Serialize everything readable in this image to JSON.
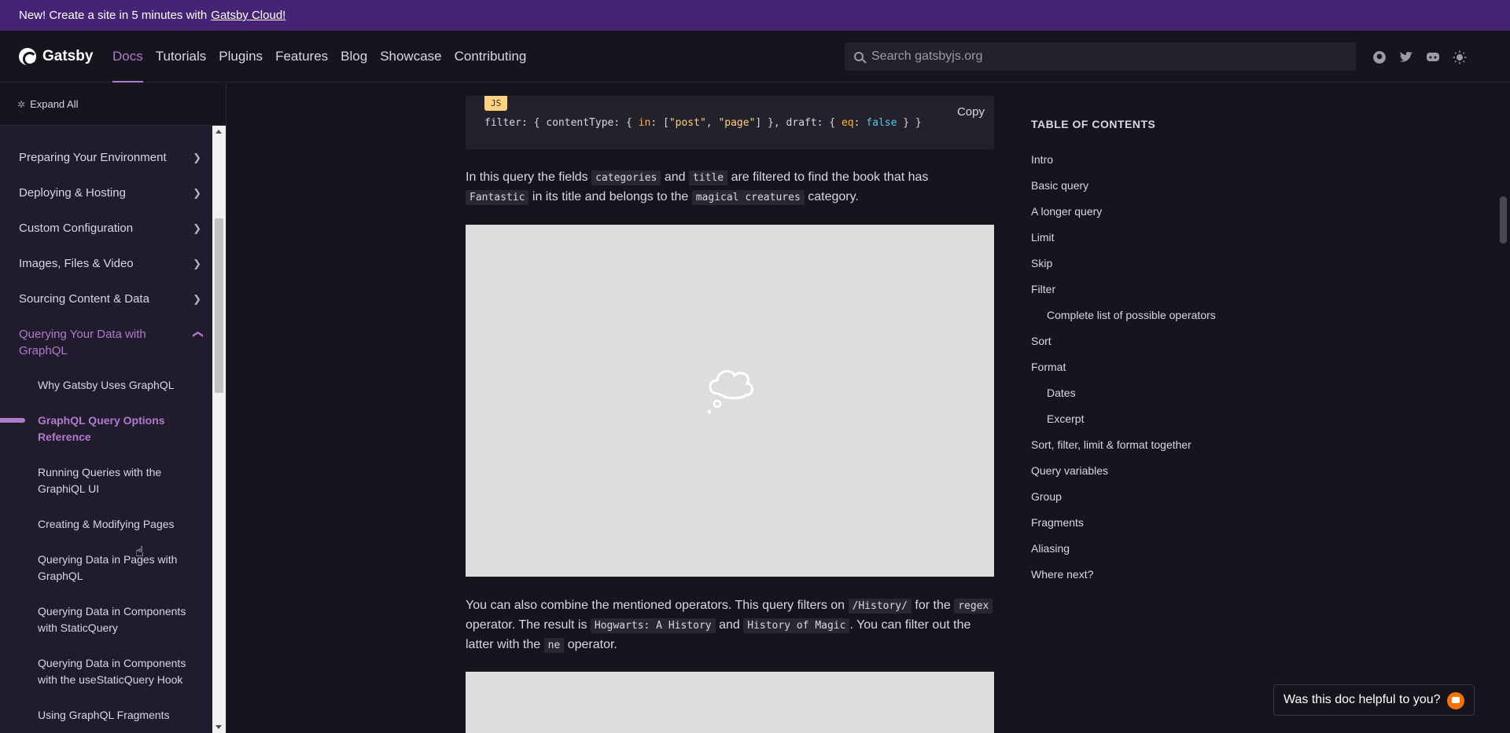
{
  "banner": {
    "text": "New! Create a site in 5 minutes with",
    "link": "Gatsby Cloud!"
  },
  "header": {
    "logo": "Gatsby",
    "nav": [
      "Docs",
      "Tutorials",
      "Plugins",
      "Features",
      "Blog",
      "Showcase",
      "Contributing"
    ],
    "active_nav": "Docs",
    "search_placeholder": "Search gatsbyjs.org",
    "icons": [
      "github-icon",
      "twitter-icon",
      "discord-icon",
      "theme-toggle-icon"
    ]
  },
  "sidebar": {
    "expand_all": "Expand All",
    "sections": [
      "Preparing Your Environment",
      "Deploying & Hosting",
      "Custom Configuration",
      "Images, Files & Video",
      "Sourcing Content & Data"
    ],
    "open_section": "Querying Your Data with GraphQL",
    "sub_items": [
      "Why Gatsby Uses GraphQL",
      "GraphQL Query Options Reference",
      "Running Queries with the GraphiQL UI",
      "Creating & Modifying Pages",
      "Querying Data in Pages with GraphQL",
      "Querying Data in Components with StaticQuery",
      "Querying Data in Components with the useStaticQuery Hook",
      "Using GraphQL Fragments"
    ],
    "active_item": "GraphQL Query Options Reference"
  },
  "content": {
    "code": {
      "lang": "JS",
      "copy": "Copy",
      "tokens": {
        "p1": "filter: { contentType: { ",
        "k1": "in",
        "p2": ": [",
        "s1": "\"post\"",
        "p3": ", ",
        "s2": "\"page\"",
        "p4": "] }, draft: { ",
        "k2": "eq",
        "p5": ": ",
        "b1": "false",
        "p6": " } }"
      }
    },
    "para1": {
      "t1": "In this query the fields",
      "c1": "categories",
      "t2": "and",
      "c2": "title",
      "t3": "are filtered to find the book that has",
      "c3": "Fantastic",
      "t4": "in its title and belongs to the",
      "c4": "magical creatures",
      "t5": "category."
    },
    "para2": {
      "t1": "You can also combine the mentioned operators. This query filters on",
      "c1": "/History/",
      "t2": "for the",
      "c2": "regex",
      "t3": "operator. The result is",
      "c3": "Hogwarts: A History",
      "t4": "and",
      "c4": "History of Magic",
      "t5": ". You can filter out the latter with the",
      "c5": "ne",
      "t6": "operator."
    }
  },
  "toc": {
    "title": "TABLE OF CONTENTS",
    "items": [
      "Intro",
      "Basic query",
      "A longer query",
      "Limit",
      "Skip",
      "Filter",
      "Complete list of possible operators",
      "Sort",
      "Format",
      "Dates",
      "Excerpt",
      "Sort, filter, limit & format together",
      "Query variables",
      "Group",
      "Fragments",
      "Aliasing",
      "Where next?"
    ]
  },
  "feedback": {
    "label": "Was this doc helpful to you?"
  },
  "colors": {
    "accent": "#b17acc",
    "banner": "#452475",
    "background": "#16141d",
    "sidebar": "#201b2d"
  }
}
